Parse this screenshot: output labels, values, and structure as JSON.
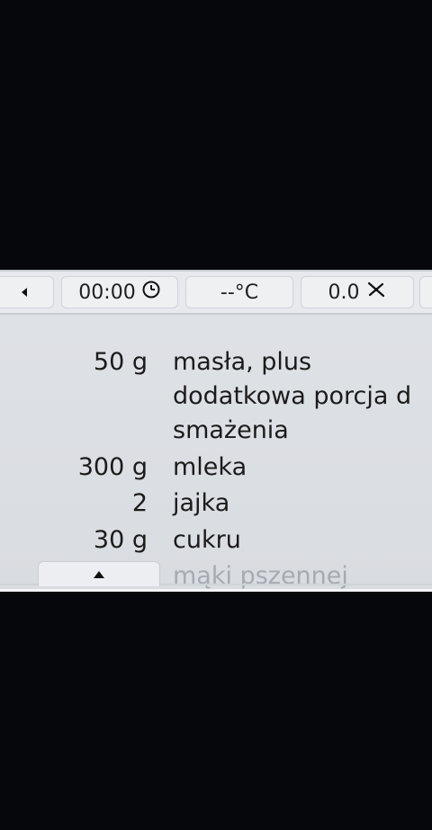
{
  "topbar": {
    "back_icon": "triangle-left-icon",
    "timer_value": "00:00",
    "timer_icon": "clock-icon",
    "temperature_value": "--°C",
    "speed_value": "0.0",
    "speed_icon": "mixing-blade-icon"
  },
  "ingredients": [
    {
      "qty": "50 g",
      "lines": [
        "masła, plus",
        "dodatkowa porcja d",
        "smażenia"
      ]
    },
    {
      "qty": "300 g",
      "lines": [
        "mleka"
      ]
    },
    {
      "qty": "2",
      "lines": [
        "jajka"
      ]
    },
    {
      "qty": "30 g",
      "lines": [
        "cukru"
      ]
    },
    {
      "qty": "",
      "lines": [
        "mąki pszennej"
      ]
    }
  ],
  "bottom": {
    "scroll_up_icon": "triangle-up-icon"
  },
  "colors": {
    "screen_bg": "#dfe2e6",
    "text": "#1b1b1b",
    "outside": "#05070c"
  }
}
